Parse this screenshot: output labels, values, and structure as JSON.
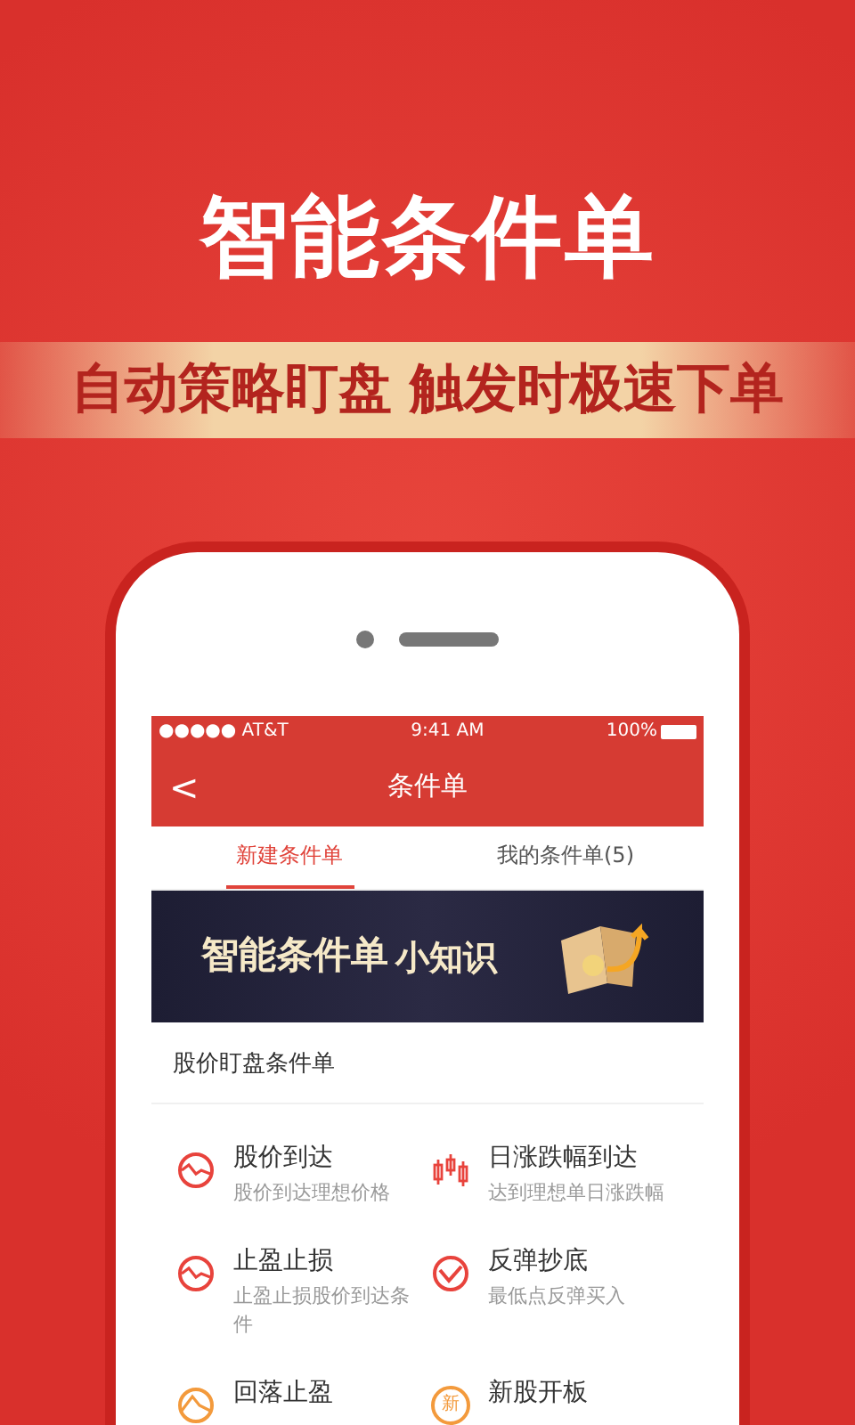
{
  "headline": "智能条件单",
  "slogan": "自动策略盯盘 触发时极速下单",
  "status_bar": {
    "carrier": "●●●●● AT&T",
    "time": "9:41 AM",
    "battery": "100%"
  },
  "nav": {
    "back": "<",
    "title": "条件单"
  },
  "tabs": [
    {
      "label": "新建条件单",
      "selected": true
    },
    {
      "label": "我的条件单(5)",
      "selected": false
    }
  ],
  "banner": {
    "title": "智能条件单",
    "suffix": "小知识"
  },
  "section": {
    "title": "股价盯盘条件单"
  },
  "items": [
    {
      "title": "股价到达",
      "subtitle": "股价到达理想价格",
      "kind": "wave",
      "color": "#e8433c"
    },
    {
      "title": "日涨跌幅到达",
      "subtitle": "达到理想单日涨跌幅",
      "kind": "candles",
      "color": "#e8433c"
    },
    {
      "title": "止盈止损",
      "subtitle": "止盈止损股价到达条件",
      "kind": "wave",
      "color": "#e8433c"
    },
    {
      "title": "反弹抄底",
      "subtitle": "最低点反弹买入",
      "kind": "check",
      "color": "#e8433c"
    },
    {
      "title": "回落止盈",
      "kind": "peak",
      "color": "#f39a3c"
    },
    {
      "title": "新股开板",
      "kind": "char",
      "glyph": "新",
      "color": "#f39a3c"
    }
  ]
}
